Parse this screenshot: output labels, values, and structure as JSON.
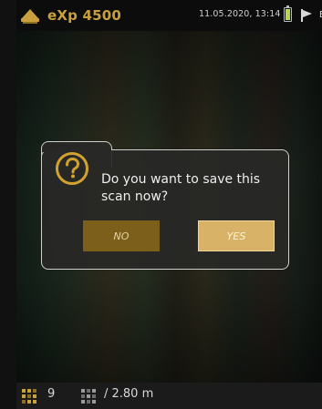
{
  "status_bar": {
    "app_name": "eXp 4500",
    "datetime": "11.05.2020, 13:14",
    "language": "EN",
    "battery_level": 1.0
  },
  "dialog": {
    "message": "Do you want to save this scan now?",
    "no_label": "NO",
    "yes_label": "YES"
  },
  "bottom_bar": {
    "scan_count": "9",
    "distance": "/ 2.80 m"
  },
  "colors": {
    "accent": "#c9a03c",
    "no_button": "#7d5f1c",
    "yes_button": "#d8b266"
  },
  "icons": {
    "logo": "logo-icon",
    "battery": "battery-icon",
    "flag": "flag-icon",
    "question": "question-icon",
    "grid": "grid-icon"
  }
}
